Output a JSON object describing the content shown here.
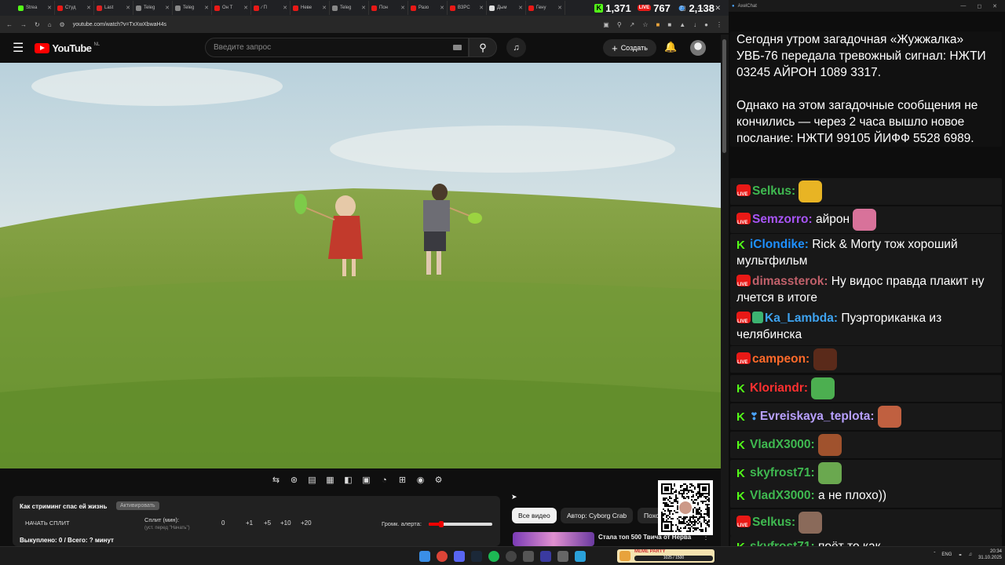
{
  "tabs": [
    {
      "label": "Strea",
      "color": "#53fc18"
    },
    {
      "label": "Студ",
      "color": "#e91916"
    },
    {
      "label": "Last",
      "color": "#d22"
    },
    {
      "label": "Teleg",
      "color": "#888"
    },
    {
      "label": "Teleg",
      "color": "#888"
    },
    {
      "label": "Он Т",
      "color": "#e91916"
    },
    {
      "label": "∕ П",
      "color": "#e91916"
    },
    {
      "label": "Неве",
      "color": "#e91916"
    },
    {
      "label": "Teleg",
      "color": "#888"
    },
    {
      "label": "Пон",
      "color": "#e91916"
    },
    {
      "label": "Разо",
      "color": "#e91916"
    },
    {
      "label": "ВЗРС",
      "color": "#e91916"
    },
    {
      "label": "Дым",
      "color": "#ddd"
    },
    {
      "label": "Гену",
      "color": "#e91916"
    }
  ],
  "stats": {
    "kick": "1,371",
    "youtube": "767",
    "twitch": "2,138"
  },
  "addressbar": {
    "url": "youtube.com/watch?v=TxXwXbwaH4s"
  },
  "youtube": {
    "logo": "YouTube",
    "country": "NL",
    "search_placeholder": "Введите запрос",
    "create_label": "Создать"
  },
  "split": {
    "title": "Как стриминг спас ей жизнь",
    "activate_label": "Активировать",
    "start_label": "НАЧАТЬ СПЛИТ",
    "split_label": "Сплит (мин):",
    "split_hint": "(уст. перед \"Начать\")",
    "current": "0",
    "steps": [
      "+1",
      "+5",
      "+10",
      "+20"
    ],
    "alert_label": "Громк. алерта:",
    "alert_volume": 0.2,
    "bought": "Выкуплено: 0 / Всего: ? минут"
  },
  "chips": [
    "Все видео",
    "Автор: Cyborg Crab",
    "Похо"
  ],
  "recommendation": {
    "title": "Стала топ 500 Твича от Нерва"
  },
  "chat": {
    "window_title": "AxelChat",
    "intro": "Сегодня утром загадочная «Жужжалка» УВБ-76 передала тревожный сигнал: НЖТИ 03245 АЙРОН 1089 3317.",
    "intro2": "Однако на этом загадочные сообщения не кончились — через 2 часа вышло новое послание: НЖТИ 99105 ЙИФФ 5528 6989.",
    "messages": [
      {
        "badge": "live",
        "user": "Selkus:",
        "color": "#3fb950",
        "text": "",
        "emote": "#e8b424"
      },
      {
        "badge": "live",
        "user": "Semzorro:",
        "color": "#a855f7",
        "text": "айрон",
        "emote": "#d8729a"
      },
      {
        "badge": "kick",
        "user": "iClondike:",
        "color": "#1e90ff",
        "text": "Rick & Morty тож хороший мультфильм",
        "emote": ""
      },
      {
        "badge": "live",
        "user": "dimassterok:",
        "color": "#c0606a",
        "text": "Ну видос правда плакит ну лчется в итоге",
        "emote": ""
      },
      {
        "badge": "live-shield",
        "user": "Ka_Lambda:",
        "color": "#3ea3f0",
        "text": "Пуэрториканка из челябинска",
        "emote": ""
      },
      {
        "badge": "live",
        "user": "campeon:",
        "color": "#ff6a2a",
        "text": "",
        "emote": "#5a2a1a"
      },
      {
        "badge": "kick",
        "user": "Kloriandr:",
        "color": "#ff3030",
        "text": "",
        "emote": "#4caf50"
      },
      {
        "badge": "kick-sword",
        "user": "Evreiskaya_teplota:",
        "color": "#b8a0ff",
        "text": "",
        "emote": "#c06040"
      },
      {
        "badge": "kick",
        "user": "VladX3000:",
        "color": "#3fb950",
        "text": "",
        "emote": "#a0522d"
      },
      {
        "badge": "kick",
        "user": "skyfrost71:",
        "color": "#3fb950",
        "text": "",
        "emote": "#6aa84f"
      },
      {
        "badge": "kick",
        "user": "VladX3000:",
        "color": "#3fb950",
        "text": "а не плохо))",
        "emote": ""
      },
      {
        "badge": "live",
        "user": "Selkus:",
        "color": "#3fb950",
        "text": "",
        "emote": "#8a6a5a"
      },
      {
        "badge": "kick",
        "user": "skyfrost71:",
        "color": "#3fb950",
        "text": "поёт то как",
        "emote": ""
      }
    ]
  },
  "taskbar": {
    "lang": "ENG",
    "time": "20:34",
    "date": "31.10.2025",
    "widget_label": "MEME PARTY",
    "widget_progress": "1025 / 1500"
  }
}
